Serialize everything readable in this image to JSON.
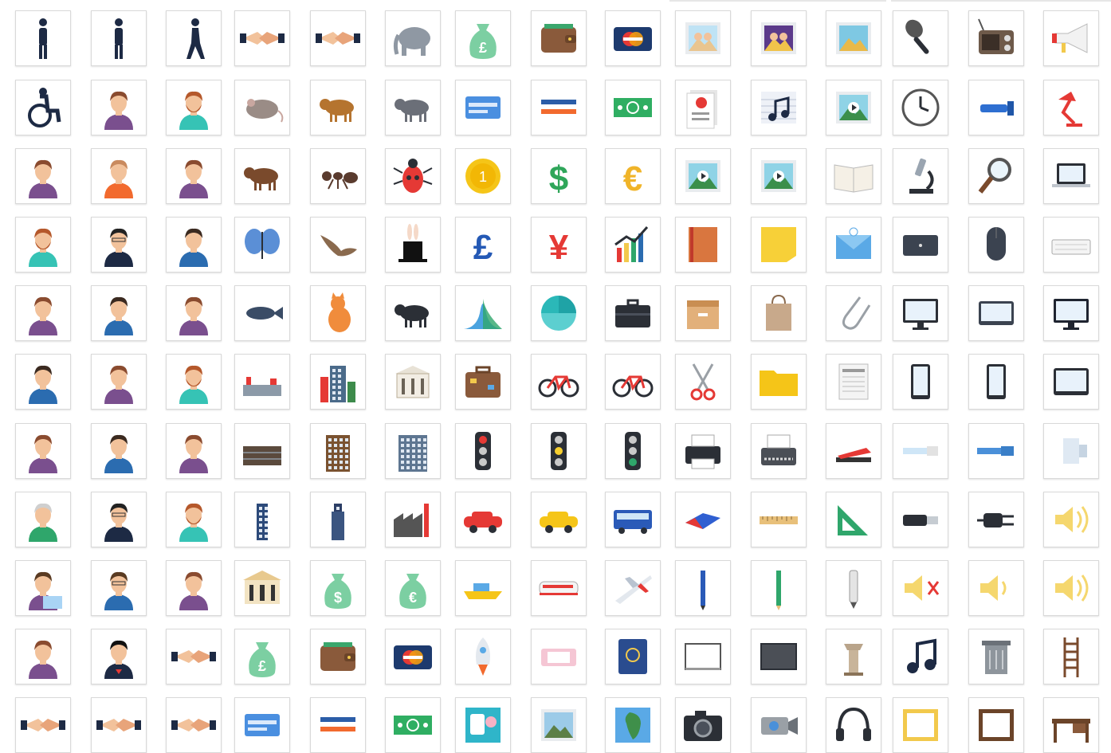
{
  "gallery": {
    "rows": [
      [
        "woman-figure-icon",
        "man-figure-icon",
        "walking-person-icon",
        "handshake-icon",
        "handshake-icon",
        "elephant-icon",
        "pound-money-bag-icon",
        "wallet-icon",
        "credit-card-icon",
        "family-photo-icon",
        "couple-photo-icon",
        "landscape-photo-icon",
        "microphone-icon",
        "radio-icon",
        "megaphone-icon"
      ],
      [
        "wheelchair-user-icon",
        "woman-avatar-icon",
        "bearded-man-avatar-icon",
        "mouse-animal-icon",
        "cow-icon",
        "pig-icon",
        "blue-card-icon",
        "striped-card-icon",
        "banknote-icon",
        "report-document-icon",
        "sheet-music-icon",
        "video-thumbnail-icon",
        "wall-clock-icon",
        "flashlight-icon",
        "desk-lamp-icon"
      ],
      [
        "woman-avatar-icon",
        "bald-man-avatar-icon",
        "woman-avatar-icon",
        "horse-icon",
        "ant-icon",
        "beetle-icon",
        "gold-coin-icon",
        "dollar-sign-icon",
        "euro-sign-icon",
        "video-thumbnail-icon",
        "video-thumbnail-icon",
        "open-book-icon",
        "microscope-icon",
        "magnifier-icon",
        "laptop-icon"
      ],
      [
        "bearded-man-avatar-icon",
        "woman-glasses-avatar-icon",
        "man-avatar-icon",
        "butterfly-icon",
        "bird-icon",
        "magic-hat-icon",
        "pound-sign-icon",
        "yen-sign-icon",
        "growth-chart-icon",
        "notebook-icon",
        "sticky-note-icon",
        "email-envelope-icon",
        "laptop-closed-icon",
        "computer-mouse-icon",
        "keyboard-icon"
      ],
      [
        "woman-avatar-icon",
        "man-avatar-icon",
        "woman-avatar-icon",
        "fish-icon",
        "cat-icon",
        "dog-icon",
        "bell-curve-icon",
        "pie-chart-icon",
        "briefcase-icon",
        "archive-box-icon",
        "shopping-bag-icon",
        "paperclip-icon",
        "monitor-icon",
        "tablet-landscape-icon",
        "desktop-monitor-icon"
      ],
      [
        "man-avatar-icon",
        "woman-avatar-icon",
        "bearded-man-avatar-icon",
        "city-skyline-icon",
        "city-buildings-icon",
        "classical-building-icon",
        "suitcase-icon",
        "bicycle-icon",
        "bicycle-icon",
        "scissors-icon",
        "folder-icon",
        "newspaper-icon",
        "smartphone-icon",
        "smartphone-icon",
        "tablet-icon"
      ],
      [
        "woman-avatar-icon",
        "man-avatar-icon",
        "woman-avatar-icon",
        "long-building-icon",
        "apartment-building-icon",
        "glass-building-icon",
        "traffic-light-red-icon",
        "traffic-light-yellow-icon",
        "traffic-light-green-icon",
        "printer-icon",
        "typewriter-icon",
        "stapler-icon",
        "usb-cable-icon",
        "ethernet-cable-icon",
        "cable-connector-icon"
      ],
      [
        "old-man-avatar-icon",
        "woman-glasses-avatar-icon",
        "bearded-man-avatar-icon",
        "skyscraper-icon",
        "tower-icon",
        "factory-icon",
        "red-car-icon",
        "taxi-icon",
        "bus-icon",
        "eraser-icon",
        "ruler-icon",
        "set-square-icon",
        "usb-plug-icon",
        "power-plug-icon",
        "speaker-loud-icon"
      ],
      [
        "woman-laptop-avatar-icon",
        "man-glasses-avatar-icon",
        "woman-avatar-icon",
        "bank-building-icon",
        "dollar-money-bag-icon",
        "euro-money-bag-icon",
        "boat-icon",
        "train-icon",
        "airplane-icon",
        "pen-icon",
        "pencil-icon",
        "marker-icon",
        "speaker-mute-icon",
        "speaker-low-icon",
        "speaker-high-icon"
      ],
      [
        "woman-avatar-icon",
        "superhero-avatar-icon",
        "handshake-icon",
        "pound-money-bag-icon",
        "wallet-icon",
        "credit-card-icon",
        "rocket-icon",
        "ticket-icon",
        "passport-icon",
        "whiteboard-icon",
        "blackboard-icon",
        "lectern-icon",
        "music-note-icon",
        "trash-can-icon",
        "ladder-icon"
      ],
      [
        "handshake-icon",
        "handshake-icon",
        "handshake-icon",
        "blue-card-icon",
        "striped-card-icon",
        "banknote-icon",
        "photo-frame-icon",
        "picture-icon",
        "map-icon",
        "camera-icon",
        "video-camera-icon",
        "headphones-icon",
        "gold-frame-icon",
        "brown-frame-icon",
        "desk-icon"
      ]
    ]
  }
}
